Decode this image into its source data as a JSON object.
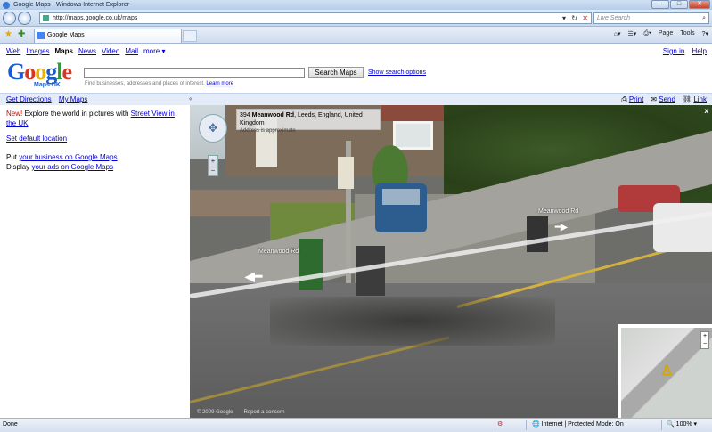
{
  "window": {
    "title": "Google Maps - Windows Internet Explorer",
    "min": "–",
    "max": "□",
    "close": "✕"
  },
  "address_bar": {
    "url": "http://maps.google.co.uk/maps",
    "search_placeholder": "Live Search"
  },
  "tab": {
    "label": "Google Maps"
  },
  "command_bar": {
    "page": "Page",
    "tools": "Tools"
  },
  "google_nav": {
    "items": [
      "Web",
      "Images",
      "Maps",
      "News",
      "Video",
      "Mail",
      "more ▾"
    ],
    "active": "Maps",
    "sign_in": "Sign in",
    "help": "Help"
  },
  "logo": {
    "letters": [
      "G",
      "o",
      "o",
      "g",
      "l",
      "e"
    ],
    "sub": "Maps UK"
  },
  "search": {
    "button": "Search Maps",
    "options": "Show search options",
    "hint": "Find businesses, addresses and places of interest.",
    "learn_more": "Learn more"
  },
  "toolstrip": {
    "directions": "Get Directions",
    "my_maps": "My Maps",
    "collapse": "«",
    "print": "Print",
    "send": "Send",
    "link": "Link"
  },
  "sidebar": {
    "new_label": "New!",
    "explore_text": "Explore the world in pictures with",
    "street_view_link": "Street View in the UK",
    "default_location": "Set default location",
    "put_text": "Put",
    "business_link": "your business on Google Maps",
    "display_text": "Display",
    "ads_link": "your ads on Google Maps"
  },
  "street_view": {
    "address_number": "394",
    "address_street": "Meanwood Rd",
    "address_place": ", Leeds, England, United Kingdom",
    "approx": "Address is approximate",
    "road_label_left": "Meanwood Rd",
    "road_label_right": "Meanwood Rd",
    "close": "x",
    "copyright": "© 2009 Google",
    "report": "Report a concern",
    "zoom_in": "+",
    "zoom_out": "−"
  },
  "status_bar": {
    "left": "Done",
    "zone": "Internet | Protected Mode: On",
    "zoom": "100%"
  }
}
